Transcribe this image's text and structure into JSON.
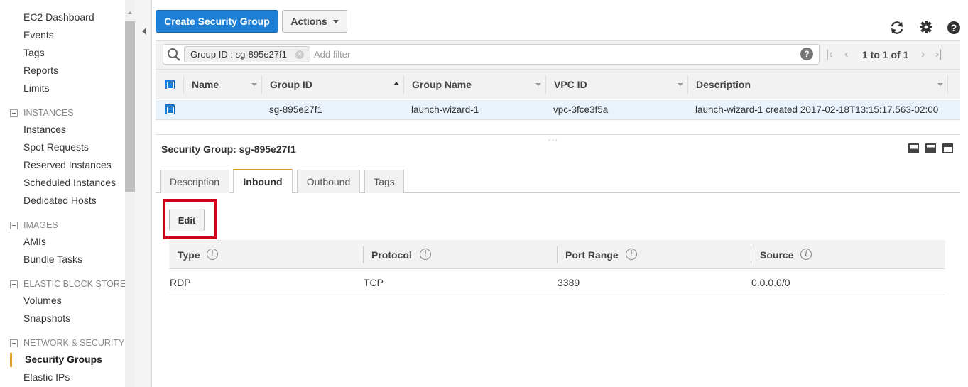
{
  "sidebar": {
    "items_top": [
      "EC2 Dashboard",
      "Events",
      "Tags",
      "Reports",
      "Limits"
    ],
    "sections": [
      {
        "title": "INSTANCES",
        "items": [
          "Instances",
          "Spot Requests",
          "Reserved Instances",
          "Scheduled Instances",
          "Dedicated Hosts"
        ]
      },
      {
        "title": "IMAGES",
        "items": [
          "AMIs",
          "Bundle Tasks"
        ]
      },
      {
        "title": "ELASTIC BLOCK STORE",
        "items": [
          "Volumes",
          "Snapshots"
        ]
      },
      {
        "title": "NETWORK & SECURITY",
        "items": [
          "Security Groups",
          "Elastic IPs"
        ]
      }
    ],
    "active_item": "Security Groups"
  },
  "toolbar": {
    "create_label": "Create Security Group",
    "actions_label": "Actions",
    "icons": [
      "refresh-icon",
      "gear-icon",
      "help-icon"
    ]
  },
  "filter": {
    "token_label": "Group ID : sg-895e27f1",
    "placeholder": "Add filter",
    "pager": "1 to 1 of 1"
  },
  "table": {
    "columns": [
      "Name",
      "Group ID",
      "Group Name",
      "VPC ID",
      "Description"
    ],
    "rows": [
      {
        "name": "",
        "group_id": "sg-895e27f1",
        "group_name": "launch-wizard-1",
        "vpc_id": "vpc-3fce3f5a",
        "description": "launch-wizard-1 created 2017-02-18T13:15:17.563-02:00"
      }
    ]
  },
  "detail": {
    "title": "Security Group: sg-895e27f1",
    "tabs": [
      "Description",
      "Inbound",
      "Outbound",
      "Tags"
    ],
    "active_tab": "Inbound",
    "edit_label": "Edit",
    "rules_columns": [
      "Type",
      "Protocol",
      "Port Range",
      "Source"
    ],
    "rules": [
      {
        "type": "RDP",
        "protocol": "TCP",
        "port_range": "3389",
        "source": "0.0.0.0/0"
      }
    ]
  },
  "colors": {
    "primary": "#1d7fd6",
    "accent": "#e89c26",
    "highlight": "#d0021b"
  }
}
